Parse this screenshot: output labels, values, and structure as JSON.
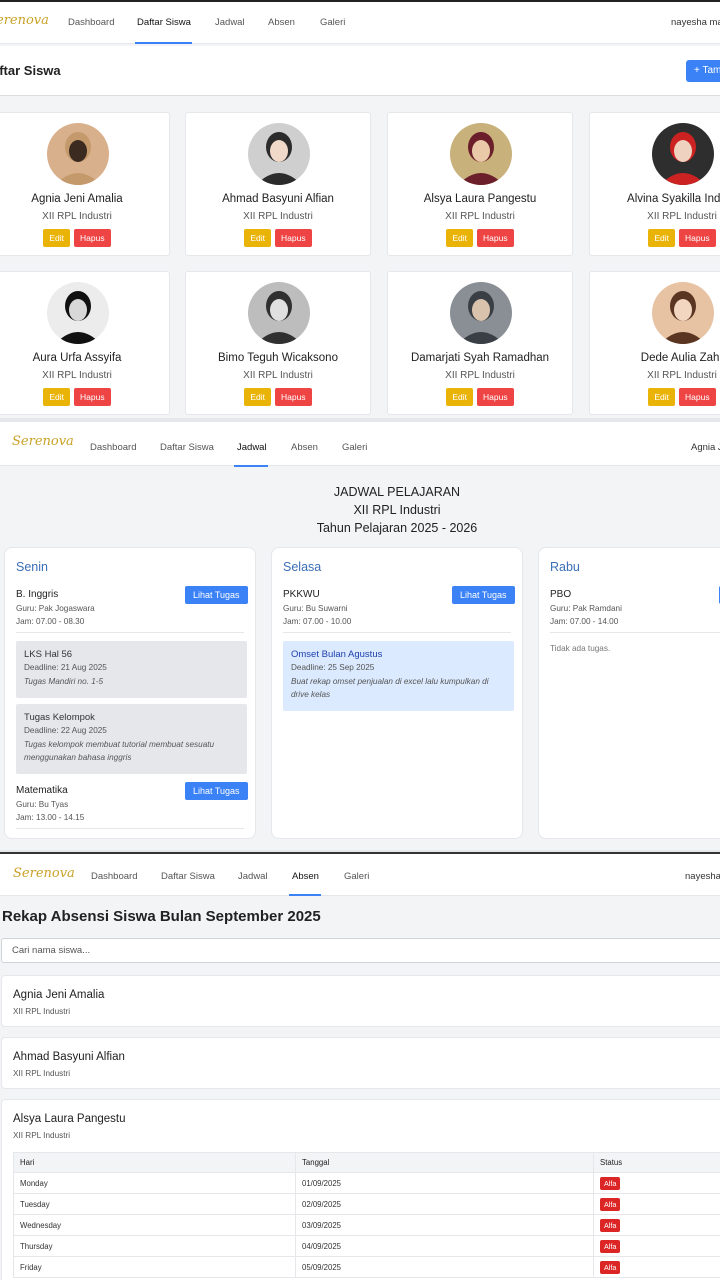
{
  "screen1": {
    "nav": {
      "logo": "erenova",
      "items": [
        "Dashboard",
        "Daftar Siswa",
        "Jadwal",
        "Absen",
        "Galeri"
      ],
      "active": "Daftar Siswa",
      "user": "nayesha mal"
    },
    "page_title": "aftar Siswa",
    "add_button": "+ Tam",
    "students": [
      {
        "name": "Agnia Jeni Amalia",
        "class": "XII RPL Industri"
      },
      {
        "name": "Ahmad Basyuni Alfian",
        "class": "XII RPL Industri"
      },
      {
        "name": "Alsya Laura Pangestu",
        "class": "XII RPL Industri"
      },
      {
        "name": "Alvina Syakilla Indriar",
        "class": "XII RPL Industri"
      },
      {
        "name": "Aura Urfa Assyifa",
        "class": "XII RPL Industri"
      },
      {
        "name": "Bimo Teguh Wicaksono",
        "class": "XII RPL Industri"
      },
      {
        "name": "Damarjati Syah Ramadhan",
        "class": "XII RPL Industri"
      },
      {
        "name": "Dede Aulia Zahr",
        "class": "XII RPL Industri"
      }
    ],
    "edit_label": "Edit",
    "delete_label": "Hapus"
  },
  "screen2": {
    "nav": {
      "logo": "Serenova",
      "items": [
        "Dashboard",
        "Daftar Siswa",
        "Jadwal",
        "Absen",
        "Galeri"
      ],
      "active": "Jadwal",
      "user": "Agnia J"
    },
    "title_lines": [
      "JADWAL PELAJARAN",
      "XII RPL Industri",
      "Tahun Pelajaran 2025 - 2026"
    ],
    "lihat_label": "Lihat Tugas",
    "days": [
      {
        "name": "Senin",
        "subjects": [
          {
            "name": "B. Inggris",
            "guru": "Guru: Pak Jogaswara",
            "jam": "Jam: 07.00 - 08.30",
            "tasks": [
              {
                "title": "LKS Hal 56",
                "deadline": "Deadline: 21 Aug 2025",
                "desc": "Tugas Mandiri no. 1-5"
              },
              {
                "title": "Tugas Kelompok",
                "deadline": "Deadline: 22 Aug 2025",
                "desc": "Tugas kelompok membuat tutorial membuat sesuatu menggunakan bahasa inggris"
              }
            ]
          },
          {
            "name": "Matematika",
            "guru": "Guru: Bu Tyas",
            "jam": "Jam: 13.00 - 14.15"
          }
        ]
      },
      {
        "name": "Selasa",
        "subjects": [
          {
            "name": "PKKWU",
            "guru": "Guru: Bu Suwarni",
            "jam": "Jam: 07.00 - 10.00",
            "tasks": [
              {
                "title": "Omset Bulan Agustus",
                "deadline": "Deadline: 25 Sep 2025",
                "desc": "Buat rekap omset penjualan di excel lalu kumpulkan di drive kelas"
              }
            ]
          }
        ]
      },
      {
        "name": "Rabu",
        "subjects": [
          {
            "name": "PBO",
            "guru": "Guru: Pak Ramdani",
            "jam": "Jam: 07.00 - 14.00",
            "no_task": "Tidak ada tugas."
          }
        ]
      }
    ]
  },
  "screen3": {
    "nav": {
      "logo": "Serenova",
      "items": [
        "Dashboard",
        "Daftar Siswa",
        "Jadwal",
        "Absen",
        "Galeri"
      ],
      "active": "Absen",
      "user": "nayesha"
    },
    "title": "Rekap Absensi Siswa Bulan September 2025",
    "search_placeholder": "Cari nama siswa...",
    "students": [
      {
        "name": "Agnia Jeni Amalia",
        "class": "XII RPL Industri"
      },
      {
        "name": "Ahmad Basyuni Alfian",
        "class": "XII RPL Industri"
      },
      {
        "name": "Alsya Laura Pangestu",
        "class": "XII RPL Industri"
      }
    ],
    "table": {
      "headers": [
        "Hari",
        "Tanggal",
        "Status"
      ],
      "rows": [
        [
          "Monday",
          "01/09/2025",
          "Alfa"
        ],
        [
          "Tuesday",
          "02/09/2025",
          "Alfa"
        ],
        [
          "Wednesday",
          "03/09/2025",
          "Alfa"
        ],
        [
          "Thursday",
          "04/09/2025",
          "Alfa"
        ],
        [
          "Friday",
          "05/09/2025",
          "Alfa"
        ]
      ]
    }
  }
}
